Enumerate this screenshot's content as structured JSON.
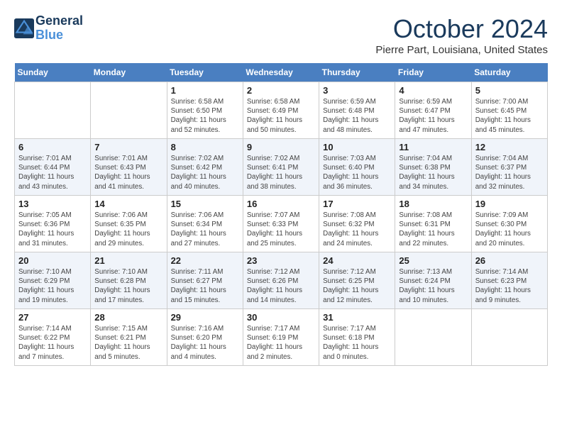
{
  "logo": {
    "line1": "General",
    "line2": "Blue"
  },
  "title": "October 2024",
  "location": "Pierre Part, Louisiana, United States",
  "weekdays": [
    "Sunday",
    "Monday",
    "Tuesday",
    "Wednesday",
    "Thursday",
    "Friday",
    "Saturday"
  ],
  "weeks": [
    [
      {
        "day": "",
        "info": ""
      },
      {
        "day": "",
        "info": ""
      },
      {
        "day": "1",
        "info": "Sunrise: 6:58 AM\nSunset: 6:50 PM\nDaylight: 11 hours\nand 52 minutes."
      },
      {
        "day": "2",
        "info": "Sunrise: 6:58 AM\nSunset: 6:49 PM\nDaylight: 11 hours\nand 50 minutes."
      },
      {
        "day": "3",
        "info": "Sunrise: 6:59 AM\nSunset: 6:48 PM\nDaylight: 11 hours\nand 48 minutes."
      },
      {
        "day": "4",
        "info": "Sunrise: 6:59 AM\nSunset: 6:47 PM\nDaylight: 11 hours\nand 47 minutes."
      },
      {
        "day": "5",
        "info": "Sunrise: 7:00 AM\nSunset: 6:45 PM\nDaylight: 11 hours\nand 45 minutes."
      }
    ],
    [
      {
        "day": "6",
        "info": "Sunrise: 7:01 AM\nSunset: 6:44 PM\nDaylight: 11 hours\nand 43 minutes."
      },
      {
        "day": "7",
        "info": "Sunrise: 7:01 AM\nSunset: 6:43 PM\nDaylight: 11 hours\nand 41 minutes."
      },
      {
        "day": "8",
        "info": "Sunrise: 7:02 AM\nSunset: 6:42 PM\nDaylight: 11 hours\nand 40 minutes."
      },
      {
        "day": "9",
        "info": "Sunrise: 7:02 AM\nSunset: 6:41 PM\nDaylight: 11 hours\nand 38 minutes."
      },
      {
        "day": "10",
        "info": "Sunrise: 7:03 AM\nSunset: 6:40 PM\nDaylight: 11 hours\nand 36 minutes."
      },
      {
        "day": "11",
        "info": "Sunrise: 7:04 AM\nSunset: 6:38 PM\nDaylight: 11 hours\nand 34 minutes."
      },
      {
        "day": "12",
        "info": "Sunrise: 7:04 AM\nSunset: 6:37 PM\nDaylight: 11 hours\nand 32 minutes."
      }
    ],
    [
      {
        "day": "13",
        "info": "Sunrise: 7:05 AM\nSunset: 6:36 PM\nDaylight: 11 hours\nand 31 minutes."
      },
      {
        "day": "14",
        "info": "Sunrise: 7:06 AM\nSunset: 6:35 PM\nDaylight: 11 hours\nand 29 minutes."
      },
      {
        "day": "15",
        "info": "Sunrise: 7:06 AM\nSunset: 6:34 PM\nDaylight: 11 hours\nand 27 minutes."
      },
      {
        "day": "16",
        "info": "Sunrise: 7:07 AM\nSunset: 6:33 PM\nDaylight: 11 hours\nand 25 minutes."
      },
      {
        "day": "17",
        "info": "Sunrise: 7:08 AM\nSunset: 6:32 PM\nDaylight: 11 hours\nand 24 minutes."
      },
      {
        "day": "18",
        "info": "Sunrise: 7:08 AM\nSunset: 6:31 PM\nDaylight: 11 hours\nand 22 minutes."
      },
      {
        "day": "19",
        "info": "Sunrise: 7:09 AM\nSunset: 6:30 PM\nDaylight: 11 hours\nand 20 minutes."
      }
    ],
    [
      {
        "day": "20",
        "info": "Sunrise: 7:10 AM\nSunset: 6:29 PM\nDaylight: 11 hours\nand 19 minutes."
      },
      {
        "day": "21",
        "info": "Sunrise: 7:10 AM\nSunset: 6:28 PM\nDaylight: 11 hours\nand 17 minutes."
      },
      {
        "day": "22",
        "info": "Sunrise: 7:11 AM\nSunset: 6:27 PM\nDaylight: 11 hours\nand 15 minutes."
      },
      {
        "day": "23",
        "info": "Sunrise: 7:12 AM\nSunset: 6:26 PM\nDaylight: 11 hours\nand 14 minutes."
      },
      {
        "day": "24",
        "info": "Sunrise: 7:12 AM\nSunset: 6:25 PM\nDaylight: 11 hours\nand 12 minutes."
      },
      {
        "day": "25",
        "info": "Sunrise: 7:13 AM\nSunset: 6:24 PM\nDaylight: 11 hours\nand 10 minutes."
      },
      {
        "day": "26",
        "info": "Sunrise: 7:14 AM\nSunset: 6:23 PM\nDaylight: 11 hours\nand 9 minutes."
      }
    ],
    [
      {
        "day": "27",
        "info": "Sunrise: 7:14 AM\nSunset: 6:22 PM\nDaylight: 11 hours\nand 7 minutes."
      },
      {
        "day": "28",
        "info": "Sunrise: 7:15 AM\nSunset: 6:21 PM\nDaylight: 11 hours\nand 5 minutes."
      },
      {
        "day": "29",
        "info": "Sunrise: 7:16 AM\nSunset: 6:20 PM\nDaylight: 11 hours\nand 4 minutes."
      },
      {
        "day": "30",
        "info": "Sunrise: 7:17 AM\nSunset: 6:19 PM\nDaylight: 11 hours\nand 2 minutes."
      },
      {
        "day": "31",
        "info": "Sunrise: 7:17 AM\nSunset: 6:18 PM\nDaylight: 11 hours\nand 0 minutes."
      },
      {
        "day": "",
        "info": ""
      },
      {
        "day": "",
        "info": ""
      }
    ]
  ]
}
